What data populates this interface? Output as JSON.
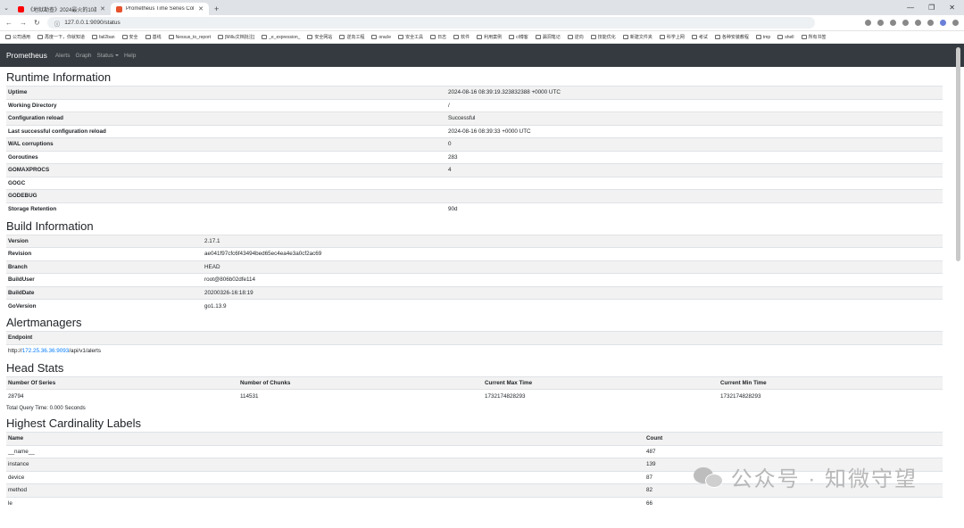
{
  "browser": {
    "tabs": [
      {
        "title": "《地狱勘查》2024最火的10部..."
      },
      {
        "title": "Prometheus Time Series Col..."
      }
    ],
    "url": "127.0.0.1:9090/status",
    "bookmarks": [
      "公司通用",
      "再度一下，你就知道",
      "fail2ban",
      "安全",
      "基线",
      "Nessus_to_report",
      "[Millu文档批注]",
      "_e_expression_",
      "安全网站",
      "逆向工程",
      "oracle",
      "安全工具",
      "日志",
      "软件",
      "利用案例",
      "cl博客",
      "漏洞笔记",
      "逆向",
      "技能优化",
      "新建文件夹",
      "科学上网",
      "考试",
      "各种安装教程",
      "tmp",
      "shell",
      "所有书签"
    ]
  },
  "nav": {
    "brand": "Prometheus",
    "links": [
      "Alerts",
      "Graph",
      "Status",
      "Help"
    ]
  },
  "runtime": {
    "title": "Runtime Information",
    "rows": [
      [
        "Uptime",
        "2024-08-16 08:39:19.323832388 +0000 UTC"
      ],
      [
        "Working Directory",
        "/"
      ],
      [
        "Configuration reload",
        "Successful"
      ],
      [
        "Last successful configuration reload",
        "2024-08-16 08:39:33 +0000 UTC"
      ],
      [
        "WAL corruptions",
        "0"
      ],
      [
        "Goroutines",
        "283"
      ],
      [
        "GOMAXPROCS",
        "4"
      ],
      [
        "GOGC",
        ""
      ],
      [
        "GODEBUG",
        ""
      ],
      [
        "Storage Retention",
        "90d"
      ]
    ]
  },
  "build": {
    "title": "Build Information",
    "rows": [
      [
        "Version",
        "2.17.1"
      ],
      [
        "Revision",
        "ae041f97cfc6f43494bed65ec4ea4e3a0cf2ac69"
      ],
      [
        "Branch",
        "HEAD"
      ],
      [
        "BuildUser",
        "root@806b02dfe114"
      ],
      [
        "BuildDate",
        "20200326-16:18:19"
      ],
      [
        "GoVersion",
        "go1.13.9"
      ]
    ]
  },
  "alertmanagers": {
    "title": "Alertmanagers",
    "header": "Endpoint",
    "endpoint_prefix": "http://",
    "endpoint_host": "172.25.36.36:9093",
    "endpoint_suffix": "/api/v1/alerts"
  },
  "head_stats": {
    "title": "Head Stats",
    "headers": [
      "Number Of Series",
      "Number of Chunks",
      "Current Max Time",
      "Current Min Time"
    ],
    "values": [
      "28794",
      "114531",
      "1732174828293",
      "1732174828293"
    ],
    "query_time": "Total Query Time: 0.000 Seconds"
  },
  "cardinality": {
    "title": "Highest Cardinality Labels",
    "headers": [
      "Name",
      "Count"
    ],
    "rows": [
      [
        "__name__",
        "487"
      ],
      [
        "instance",
        "139"
      ],
      [
        "device",
        "87"
      ],
      [
        "method",
        "82"
      ],
      [
        "le",
        "66"
      ]
    ]
  },
  "watermark": "公众号 · 知微守望"
}
